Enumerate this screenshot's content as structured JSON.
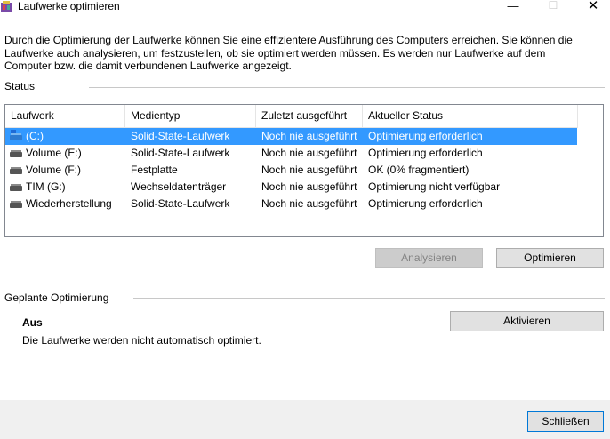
{
  "window": {
    "title": "Laufwerke optimieren",
    "minimize_glyph": "—",
    "maximize_glyph": "☐",
    "close_glyph": "✕"
  },
  "description": "Durch die Optimierung der Laufwerke können Sie eine effizientere Ausführung des Computers erreichen. Sie können die Laufwerke auch analysieren, um festzustellen, ob sie optimiert werden müssen. Es werden nur Laufwerke auf dem Computer bzw. die damit verbundenen Laufwerke angezeigt.",
  "status": {
    "label": "Status",
    "columns": [
      "Laufwerk",
      "Medientyp",
      "Zuletzt ausgeführt",
      "Aktueller Status"
    ],
    "rows": [
      {
        "icon": "system-drive-icon",
        "drive": "(C:)",
        "media": "Solid-State-Laufwerk",
        "last_run": "Noch nie ausgeführt",
        "state": "Optimierung erforderlich",
        "selected": true
      },
      {
        "icon": "drive-icon",
        "drive": "Volume (E:)",
        "media": "Solid-State-Laufwerk",
        "last_run": "Noch nie ausgeführt",
        "state": "Optimierung erforderlich"
      },
      {
        "icon": "drive-icon",
        "drive": "Volume (F:)",
        "media": "Festplatte",
        "last_run": "Noch nie ausgeführt",
        "state": "OK (0% fragmentiert)"
      },
      {
        "icon": "drive-icon",
        "drive": "TIM (G:)",
        "media": "Wechseldatenträger",
        "last_run": "Noch nie ausgeführt",
        "state": "Optimierung nicht verfügbar"
      },
      {
        "icon": "drive-icon",
        "drive": "Wiederherstellung",
        "media": "Solid-State-Laufwerk",
        "last_run": "Noch nie ausgeführt",
        "state": "Optimierung erforderlich"
      }
    ],
    "analyze_label": "Analysieren",
    "optimize_label": "Optimieren"
  },
  "schedule": {
    "label": "Geplante Optimierung",
    "state": "Aus",
    "detail": "Die Laufwerke werden nicht automatisch optimiert.",
    "activate_label": "Aktivieren"
  },
  "footer": {
    "close_label": "Schließen"
  }
}
